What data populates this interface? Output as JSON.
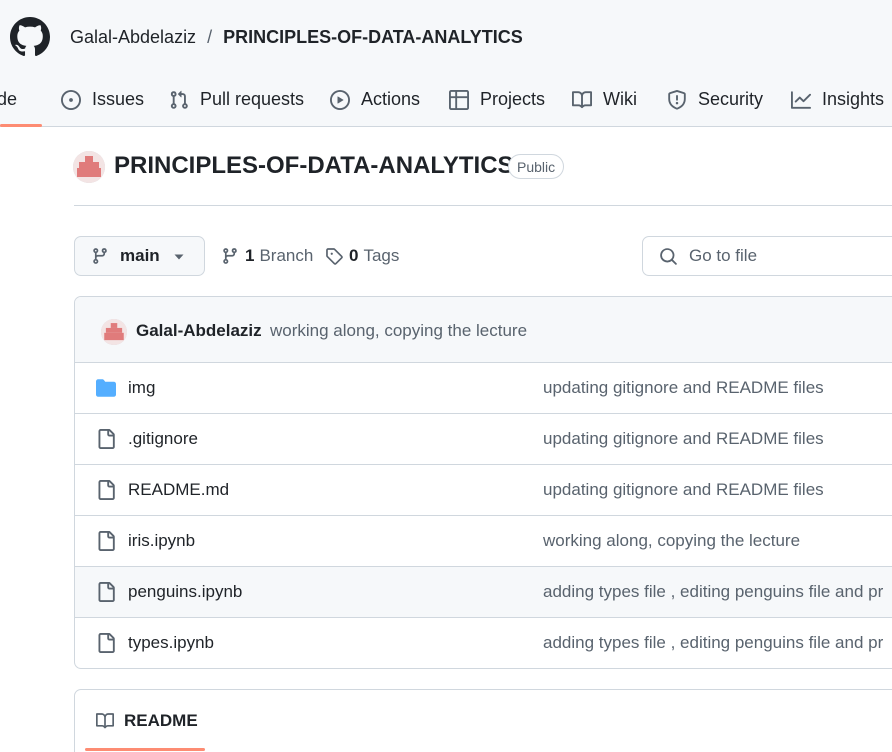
{
  "breadcrumb": {
    "owner": "Galal-Abdelaziz",
    "separator": "/",
    "repo": "PRINCIPLES-OF-DATA-ANALYTICS"
  },
  "nav_tabs": [
    {
      "label": "Code",
      "icon": "code-icon",
      "active": true
    },
    {
      "label": "Issues",
      "icon": "issue-opened-icon"
    },
    {
      "label": "Pull requests",
      "icon": "git-pull-request-icon"
    },
    {
      "label": "Actions",
      "icon": "play-icon"
    },
    {
      "label": "Projects",
      "icon": "table-icon"
    },
    {
      "label": "Wiki",
      "icon": "book-icon"
    },
    {
      "label": "Security",
      "icon": "shield-icon"
    },
    {
      "label": "Insights",
      "icon": "graph-icon"
    }
  ],
  "repo": {
    "title": "PRINCIPLES-OF-DATA-ANALYTICS",
    "visibility": "Public"
  },
  "branch": {
    "current": "main",
    "branch_count": "1",
    "branch_label": "Branch",
    "tag_count": "0",
    "tag_label": "Tags",
    "go_to_file_placeholder": "Go to file"
  },
  "latest_commit": {
    "author": "Galal-Abdelaziz",
    "message": "working along, copying the lecture"
  },
  "files": [
    {
      "name": "img",
      "type": "folder",
      "commit_message": "updating gitignore and README files"
    },
    {
      "name": ".gitignore",
      "type": "file",
      "commit_message": "updating gitignore and README files"
    },
    {
      "name": "README.md",
      "type": "file",
      "commit_message": "updating gitignore and README files"
    },
    {
      "name": "iris.ipynb",
      "type": "file",
      "commit_message": "working along, copying the lecture"
    },
    {
      "name": "penguins.ipynb",
      "type": "file",
      "commit_message": "adding types file , editing penguins file and pr"
    },
    {
      "name": "types.ipynb",
      "type": "file",
      "commit_message": "adding types file , editing penguins file and pr"
    }
  ],
  "readme": {
    "tab_label": "README"
  },
  "colors": {
    "accent_underline": "#fd8c73",
    "folder": "#54aeff",
    "muted_text": "#59636e",
    "border": "#d0d7de"
  }
}
